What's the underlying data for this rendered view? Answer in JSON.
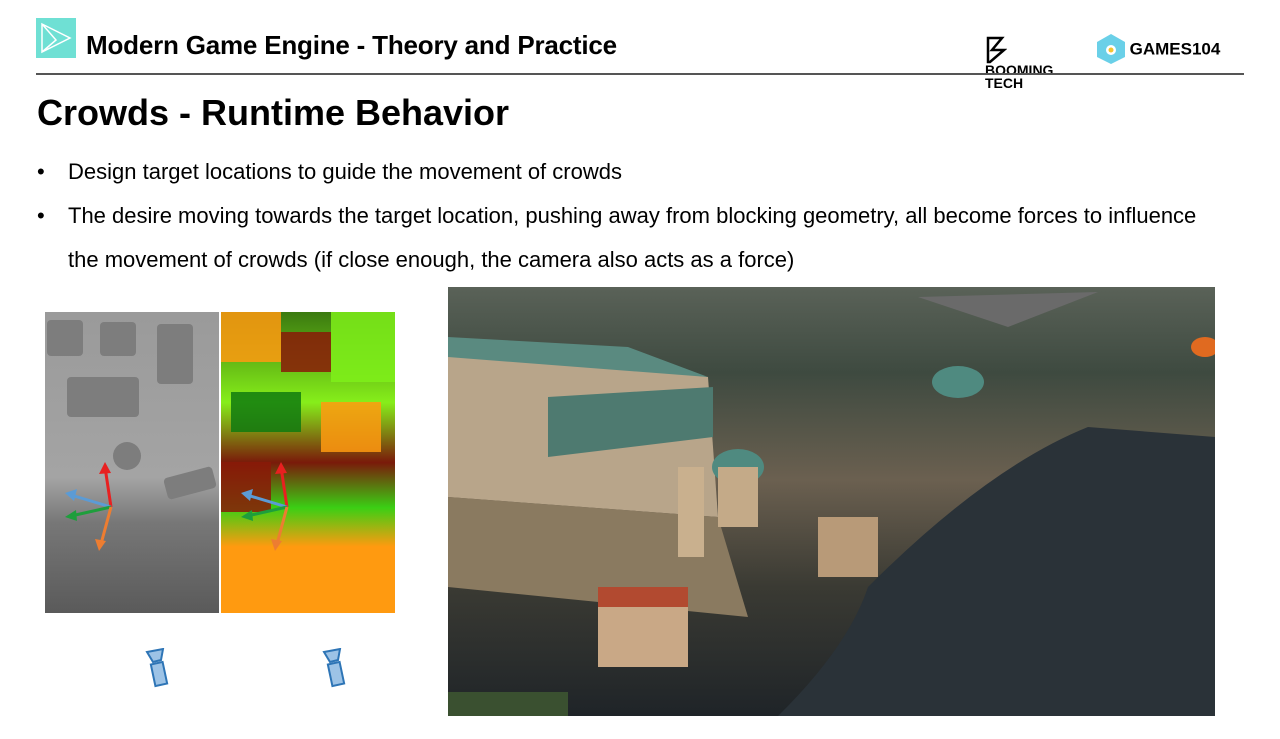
{
  "header": {
    "title": "Modern Game Engine - Theory and Practice",
    "brand_booming": "BOOMING TECH",
    "brand_games": "GAMES104"
  },
  "slide": {
    "title": "Crowds - Runtime Behavior",
    "bullets": [
      {
        "marker": "•",
        "text": "Design target locations to guide the movement of crowds"
      },
      {
        "marker": "•",
        "text": "The desire moving towards the target location, pushing away from blocking geometry, all become forces to influence the movement of crowds (if close enough, the camera also acts as a force)"
      }
    ]
  },
  "colors": {
    "accent": "#6fe0d4",
    "arrow_red": "#e82020",
    "arrow_blue": "#5b9bd5",
    "arrow_green": "#1e9e3c",
    "arrow_orange": "#ed7d31",
    "camera": "#2e75b6"
  }
}
